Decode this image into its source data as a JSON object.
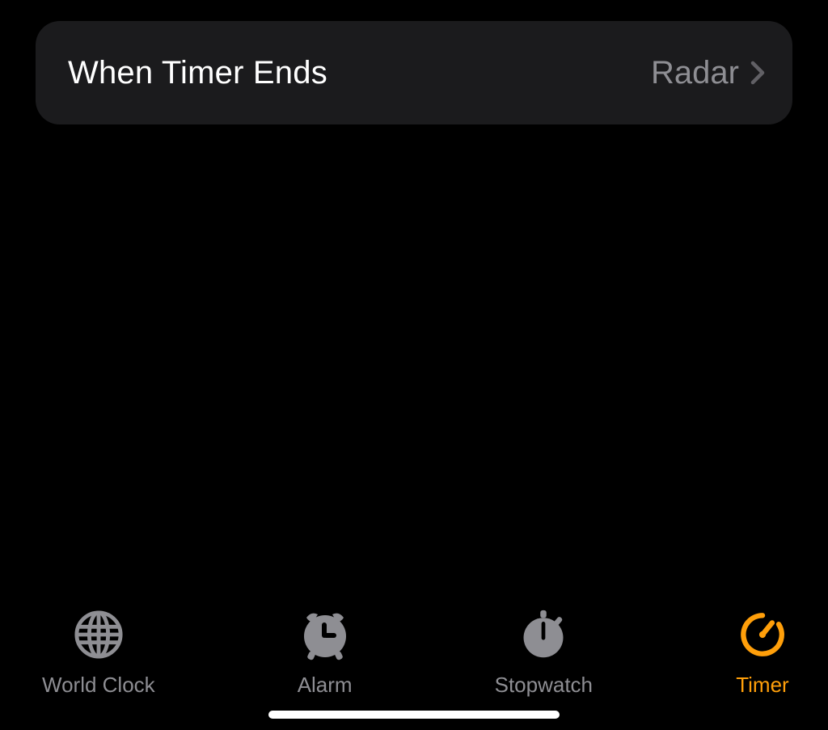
{
  "setting": {
    "label": "When Timer Ends",
    "value": "Radar"
  },
  "tabs": {
    "world_clock": {
      "label": "World Clock",
      "active": false
    },
    "alarm": {
      "label": "Alarm",
      "active": false
    },
    "stopwatch": {
      "label": "Stopwatch",
      "active": false
    },
    "timer": {
      "label": "Timer",
      "active": true
    }
  }
}
